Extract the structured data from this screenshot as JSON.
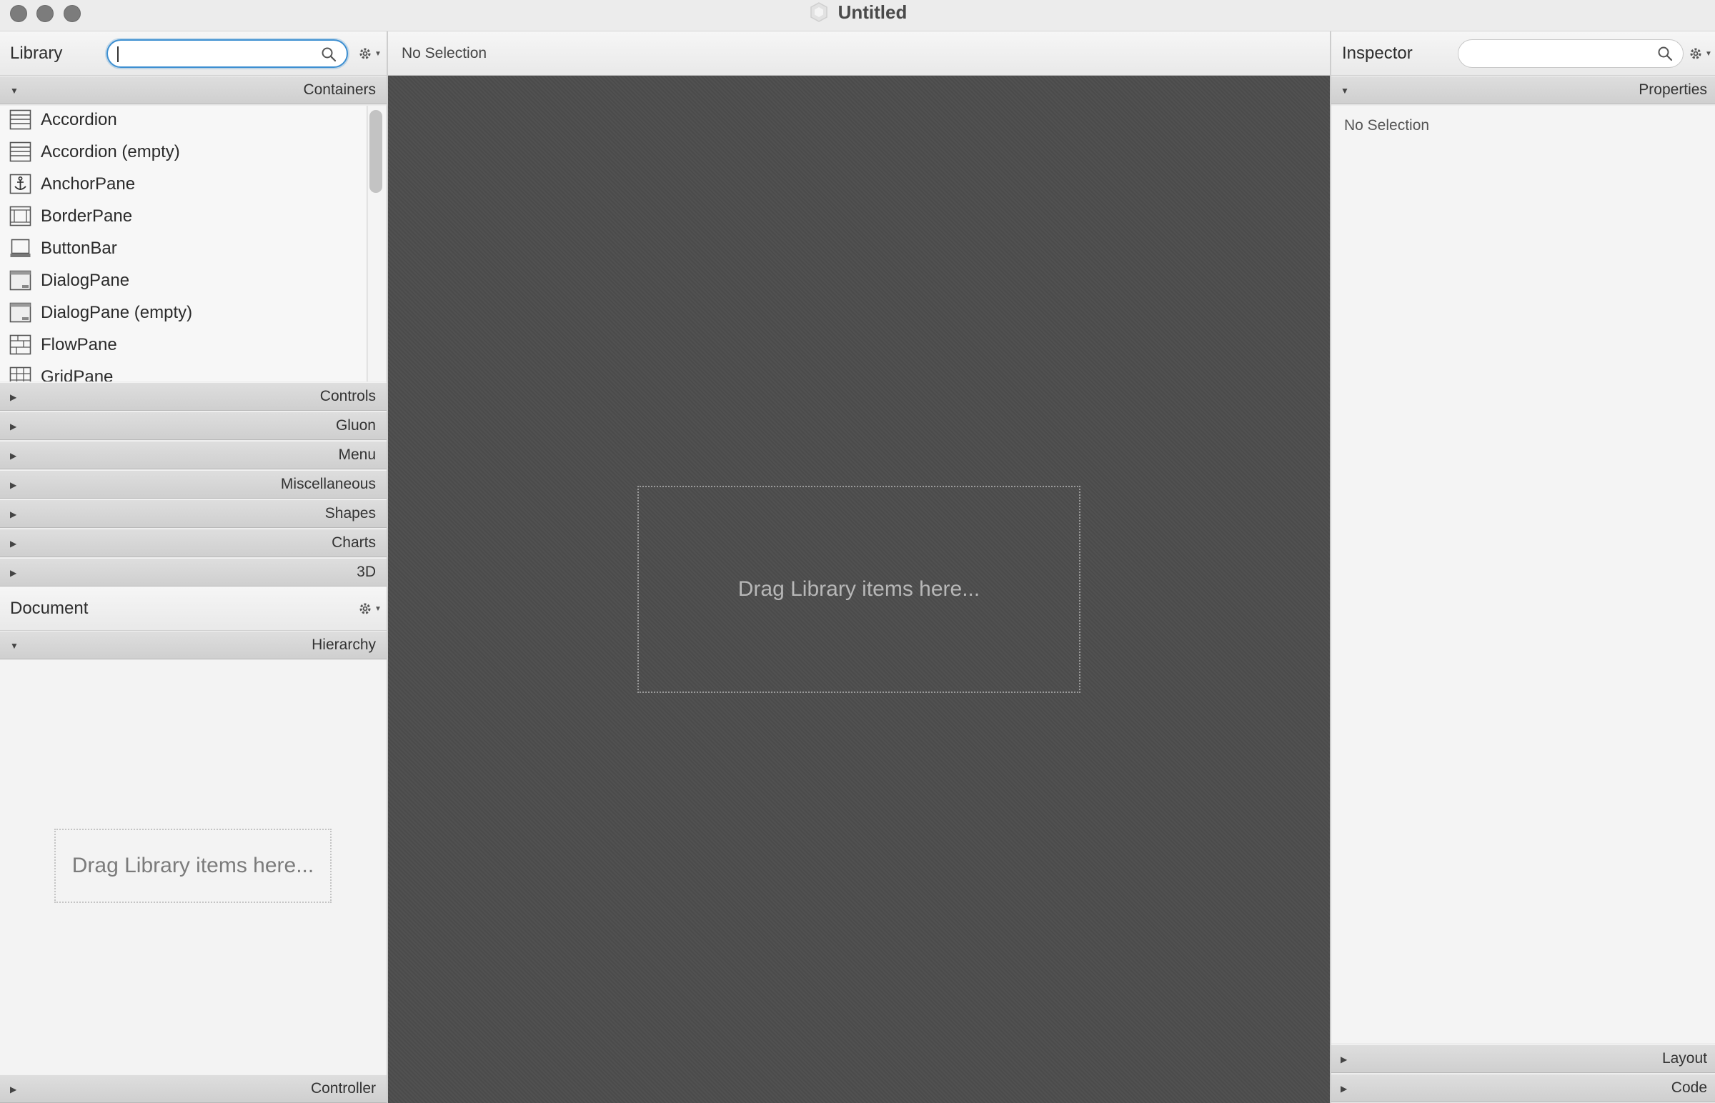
{
  "window": {
    "title": "Untitled"
  },
  "library": {
    "title": "Library",
    "search_value": "",
    "search_placeholder": "",
    "sections": {
      "containers": "Containers",
      "controls": "Controls",
      "gluon": "Gluon",
      "menu": "Menu",
      "miscellaneous": "Miscellaneous",
      "shapes": "Shapes",
      "charts": "Charts",
      "three_d": "3D"
    },
    "items": [
      {
        "label": "Accordion",
        "icon": "accordion-icon"
      },
      {
        "label": "Accordion  (empty)",
        "icon": "accordion-icon"
      },
      {
        "label": "AnchorPane",
        "icon": "anchor-icon"
      },
      {
        "label": "BorderPane",
        "icon": "border-pane-icon"
      },
      {
        "label": "ButtonBar",
        "icon": "button-bar-icon"
      },
      {
        "label": "DialogPane",
        "icon": "dialog-pane-icon"
      },
      {
        "label": "DialogPane  (empty)",
        "icon": "dialog-pane-icon"
      },
      {
        "label": "FlowPane",
        "icon": "flow-pane-icon"
      },
      {
        "label": "GridPane",
        "icon": "grid-pane-icon"
      }
    ]
  },
  "center": {
    "selection_label": "No Selection",
    "drop_hint": "Drag Library items here..."
  },
  "document": {
    "title": "Document",
    "hierarchy_label": "Hierarchy",
    "drop_hint": "Drag Library items here...",
    "controller_label": "Controller"
  },
  "inspector": {
    "title": "Inspector",
    "search_value": "",
    "properties_label": "Properties",
    "empty_text": "No Selection",
    "layout_label": "Layout",
    "code_label": "Code"
  },
  "colors": {
    "canvas": "#4b4b4b",
    "focus_ring": "#3d8fd1",
    "panel_bg": "#f4f4f4"
  }
}
